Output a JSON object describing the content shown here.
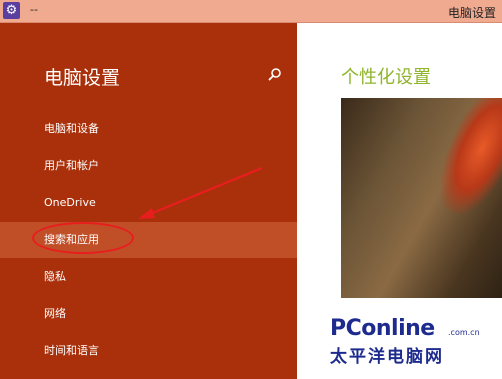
{
  "titlebar": {
    "app_icon_glyph": "⚙",
    "dash": "--",
    "window_title": "电脑设置"
  },
  "sidebar": {
    "heading": "电脑设置",
    "items": [
      {
        "label": "电脑和设备"
      },
      {
        "label": "用户和帐户"
      },
      {
        "label": "OneDrive"
      },
      {
        "label": "搜索和应用",
        "selected": true
      },
      {
        "label": "隐私"
      },
      {
        "label": "网络"
      },
      {
        "label": "时间和语言"
      }
    ]
  },
  "content": {
    "heading": "个性化设置"
  },
  "watermark": {
    "brand": "PConline",
    "domain": ".com.cn",
    "chinese": "太平洋电脑网"
  },
  "colors": {
    "sidebar_bg": "#a9300a",
    "selected_bg": "#c04f28",
    "accent_green": "#8fb52c",
    "annotation_red": "#e81e1e"
  }
}
